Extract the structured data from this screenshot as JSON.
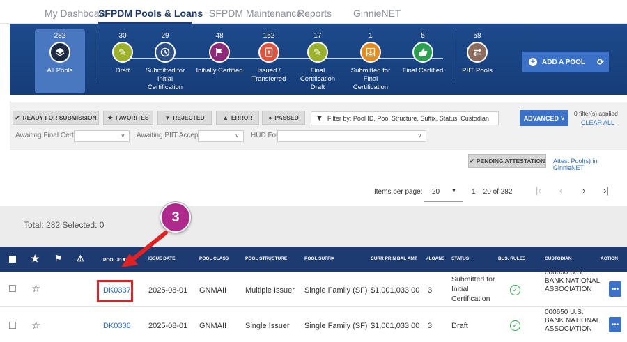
{
  "nav": {
    "tabs": [
      "My Dashboard",
      "SFPDM Pools & Loans",
      "SFPDM Maintenance",
      "Reports",
      "GinnieNET"
    ],
    "active_tab": "SFPDM Pools & Loans"
  },
  "steps": [
    {
      "count": "282",
      "label": "All Pools",
      "icon": "layers-icon",
      "color": "#1d2b44"
    },
    {
      "count": "30",
      "label": "Draft",
      "icon": "pencil-icon",
      "color": "#9bb22a"
    },
    {
      "count": "29",
      "label": "Submitted for Initial Certification",
      "icon": "clock-icon",
      "color": "#2b4f86"
    },
    {
      "count": "48",
      "label": "Initially Certified",
      "icon": "flag-icon",
      "color": "#8e2a78"
    },
    {
      "count": "152",
      "label": "Issued / Transferred",
      "icon": "upload-file-icon",
      "color": "#e0523a"
    },
    {
      "count": "17",
      "label": "Final Certification Draft",
      "icon": "pencil-icon",
      "color": "#9bb22a"
    },
    {
      "count": "1",
      "label": "Submitted for Final Certification",
      "icon": "inbox-icon",
      "color": "#e58a1c"
    },
    {
      "count": "5",
      "label": "Final Certified",
      "icon": "thumbs-up-icon",
      "color": "#2aa14e"
    },
    {
      "count": "58",
      "label": "PIIT Pools",
      "icon": "transfer-icon",
      "color": "#8b6b5a"
    }
  ],
  "add_pool_label": "ADD A POOL",
  "filters": {
    "buttons": [
      "READY FOR SUBMISSION",
      "FAVORITES",
      "REJECTED",
      "ERROR",
      "PASSED"
    ],
    "search_placeholder": "Filter by: Pool ID, Pool Structure, Suffix, Status, Custodian",
    "advanced_label": "ADVANCED",
    "applied_text": "0 filter(s) applied",
    "clear_all": "CLEAR ALL",
    "select_labels": [
      "Awaiting Final Cert.",
      "Awaiting PIIT Acceptance",
      "HUD Forms"
    ]
  },
  "attest": {
    "button": "PENDING ATTESTATION",
    "link": "Attest Pool(s) in GinnieNET"
  },
  "pagination": {
    "items_per_page_label": "Items per page:",
    "items_per_page": "20",
    "range": "1 – 20 of 282"
  },
  "total_text": "Total: 282 Selected: 0",
  "annotation_number": "3",
  "table": {
    "headers": [
      "POOL ID",
      "ISSUE DATE",
      "POOL CLASS",
      "POOL STRUCTURE",
      "POOL SUFFIX",
      "CURR PRIN BAL AMT",
      "#LOANS",
      "STATUS",
      "BUS. RULES",
      "CUSTODIAN",
      "ACTION"
    ],
    "rows": [
      {
        "pool_id": "DK0337",
        "issue_date": "2025-08-01",
        "pool_class": "GNMAII",
        "structure": "Multiple Issuer",
        "suffix": "Single Family (SF)",
        "balance": "$1,001,033.00",
        "loans": "3",
        "status": "Submitted for Initial Certification",
        "custodian": "000650 U.S. BANK NATIONAL ASSOCIATION"
      },
      {
        "pool_id": "DK0336",
        "issue_date": "2025-08-01",
        "pool_class": "GNMAII",
        "structure": "Single Issuer",
        "suffix": "Single Family (SF)",
        "balance": "$1,001,033.00",
        "loans": "3",
        "status": "Draft",
        "custodian": "000650 U.S. BANK NATIONAL ASSOCIATION"
      }
    ]
  }
}
